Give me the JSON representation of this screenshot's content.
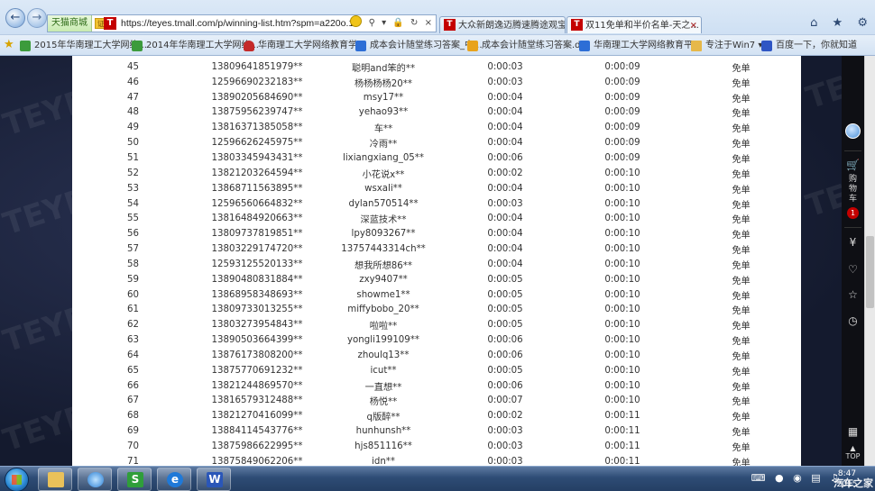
{
  "browser": {
    "site_chip": "天猫商城",
    "chip_badge": "证",
    "url": "https://teyes.tmall.com/p/winning-list.htm?spm=a220o.1000855.w",
    "tabs": [
      {
        "label": "大众新朗逸迈腾速腾途观宝来...",
        "icon": "tmall-icon"
      },
      {
        "label": "双11免单和半价名单-天之...",
        "icon": "tmall-icon"
      }
    ]
  },
  "favorites": [
    {
      "label": "2015年华南理工大学网络...",
      "icon": "green-page-icon"
    },
    {
      "label": "2014年华南理工大学网络...",
      "icon": "green-page-icon"
    },
    {
      "label": "华南理工大学网络教育学...",
      "icon": "red-badge-icon"
    },
    {
      "label": "成本会计随堂练习答案_中...",
      "icon": "blue-page-icon"
    },
    {
      "label": "成本会计随堂练习答案.d...",
      "icon": "orange-page-icon"
    },
    {
      "label": "华南理工大学网络教育平...",
      "icon": "blue-page-icon"
    },
    {
      "label": "专注于Win7",
      "icon": "folder-icon"
    },
    {
      "label": "百度一下，你就知道",
      "icon": "baidu-icon"
    }
  ],
  "winners": [
    {
      "no": "45",
      "phone": "13809641851979**",
      "name": "聪明and笨的**",
      "t1": "0:00:03",
      "t2": "0:00:09",
      "result": "免单"
    },
    {
      "no": "46",
      "phone": "12596690232183**",
      "name": "杨杨杨杨20**",
      "t1": "0:00:03",
      "t2": "0:00:09",
      "result": "免单"
    },
    {
      "no": "47",
      "phone": "13890205684690**",
      "name": "msy17**",
      "t1": "0:00:04",
      "t2": "0:00:09",
      "result": "免单"
    },
    {
      "no": "48",
      "phone": "13875956239747**",
      "name": "yehao93**",
      "t1": "0:00:04",
      "t2": "0:00:09",
      "result": "免单"
    },
    {
      "no": "49",
      "phone": "13816371385058**",
      "name": "车**",
      "t1": "0:00:04",
      "t2": "0:00:09",
      "result": "免单"
    },
    {
      "no": "50",
      "phone": "12596626245975**",
      "name": "冷雨**",
      "t1": "0:00:04",
      "t2": "0:00:09",
      "result": "免单"
    },
    {
      "no": "51",
      "phone": "13803345943431**",
      "name": "lixiangxiang_05**",
      "t1": "0:00:06",
      "t2": "0:00:09",
      "result": "免单"
    },
    {
      "no": "52",
      "phone": "13821203264594**",
      "name": "小花说x**",
      "t1": "0:00:02",
      "t2": "0:00:10",
      "result": "免单"
    },
    {
      "no": "53",
      "phone": "13868711563895**",
      "name": "wsxali**",
      "t1": "0:00:04",
      "t2": "0:00:10",
      "result": "免单"
    },
    {
      "no": "54",
      "phone": "12596560664832**",
      "name": "dylan570514**",
      "t1": "0:00:03",
      "t2": "0:00:10",
      "result": "免单"
    },
    {
      "no": "55",
      "phone": "13816484920663**",
      "name": "深蓝技术**",
      "t1": "0:00:04",
      "t2": "0:00:10",
      "result": "免单"
    },
    {
      "no": "56",
      "phone": "13809737819851**",
      "name": "lpy8093267**",
      "t1": "0:00:04",
      "t2": "0:00:10",
      "result": "免单"
    },
    {
      "no": "57",
      "phone": "13803229174720**",
      "name": "13757443314ch**",
      "t1": "0:00:04",
      "t2": "0:00:10",
      "result": "免单"
    },
    {
      "no": "58",
      "phone": "12593125520133**",
      "name": "想我所想86**",
      "t1": "0:00:04",
      "t2": "0:00:10",
      "result": "免单"
    },
    {
      "no": "59",
      "phone": "13890480831884**",
      "name": "zxy9407**",
      "t1": "0:00:05",
      "t2": "0:00:10",
      "result": "免单"
    },
    {
      "no": "60",
      "phone": "13868958348693**",
      "name": "showme1**",
      "t1": "0:00:05",
      "t2": "0:00:10",
      "result": "免单"
    },
    {
      "no": "61",
      "phone": "13809733013255**",
      "name": "miffybobo_20**",
      "t1": "0:00:05",
      "t2": "0:00:10",
      "result": "免单"
    },
    {
      "no": "62",
      "phone": "13803273954843**",
      "name": "啦啦**",
      "t1": "0:00:05",
      "t2": "0:00:10",
      "result": "免单"
    },
    {
      "no": "63",
      "phone": "13890503664399**",
      "name": "yongli199109**",
      "t1": "0:00:06",
      "t2": "0:00:10",
      "result": "免单"
    },
    {
      "no": "64",
      "phone": "13876173808200**",
      "name": "zhoulq13**",
      "t1": "0:00:06",
      "t2": "0:00:10",
      "result": "免单"
    },
    {
      "no": "65",
      "phone": "13875770691232**",
      "name": "icut**",
      "t1": "0:00:05",
      "t2": "0:00:10",
      "result": "免单"
    },
    {
      "no": "66",
      "phone": "13821244869570**",
      "name": "一直想**",
      "t1": "0:00:06",
      "t2": "0:00:10",
      "result": "免单"
    },
    {
      "no": "67",
      "phone": "13816579312488**",
      "name": "杨悦**",
      "t1": "0:00:07",
      "t2": "0:00:10",
      "result": "免单"
    },
    {
      "no": "68",
      "phone": "13821270416099**",
      "name": "q版醉**",
      "t1": "0:00:02",
      "t2": "0:00:11",
      "result": "免单"
    },
    {
      "no": "69",
      "phone": "13884114543776**",
      "name": "hunhunsh**",
      "t1": "0:00:03",
      "t2": "0:00:11",
      "result": "免单"
    },
    {
      "no": "70",
      "phone": "13875986622995**",
      "name": "hjs851116**",
      "t1": "0:00:03",
      "t2": "0:00:11",
      "result": "免单"
    },
    {
      "no": "71",
      "phone": "13875849062206**",
      "name": "idn**",
      "t1": "0:00:03",
      "t2": "0:00:11",
      "result": "免单"
    }
  ],
  "sidebar": {
    "cart_label": "购物车",
    "cart_count": "1",
    "top_label": "TOP"
  },
  "watermark_text": "TEYES",
  "taskbar": {
    "apps": [
      {
        "name": "explorer",
        "glyph": ""
      },
      {
        "name": "media-player",
        "glyph": ""
      },
      {
        "name": "s-app",
        "glyph": "S"
      },
      {
        "name": "ie",
        "glyph": "e"
      },
      {
        "name": "wps-writer",
        "glyph": "W"
      }
    ],
    "clock_time": "8:47",
    "clock_date": "2015",
    "corner_logo": "汽车之家"
  },
  "colors": {
    "tmall_red": "#c40000",
    "page_bg": "#141a2e",
    "side_bar": "#0e0f14"
  }
}
